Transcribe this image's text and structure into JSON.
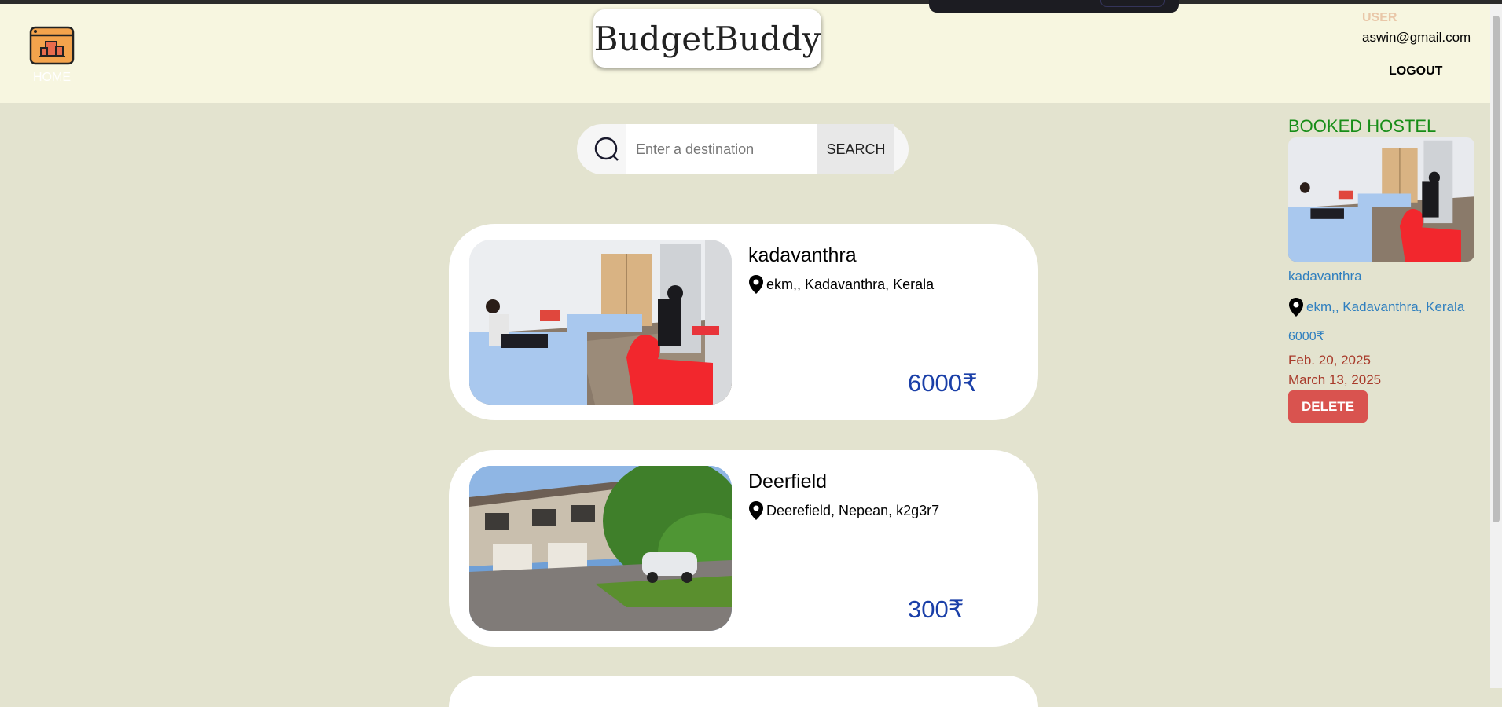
{
  "header": {
    "home_label": "HOME",
    "brand": "BudgetBuddy",
    "user_label": "USER",
    "user_email": "aswin@gmail.com",
    "logout_label": "LOGOUT"
  },
  "search": {
    "placeholder": "Enter a destination",
    "button_label": "SEARCH"
  },
  "listings": [
    {
      "name": "kadavanthra",
      "location": "ekm,, Kadavanthra, Kerala",
      "price": "6000₹",
      "image": "hostel-room"
    },
    {
      "name": "Deerfield",
      "location": "Deerefield, Nepean, k2g3r7",
      "price": "300₹",
      "image": "townhouse"
    }
  ],
  "booked": {
    "title": "BOOKED HOSTEL",
    "name": "kadavanthra",
    "location": "ekm,, Kadavanthra, Kerala",
    "price": "6000₹",
    "check_in": "Feb. 20, 2025",
    "check_out": "March 13, 2025",
    "delete_label": "DELETE"
  },
  "colors": {
    "page_bg": "#e3e3cf",
    "header_bg": "#f7f6e0",
    "price": "#1a3fa8",
    "booked_title": "#178d17",
    "booked_link": "#2f7fbf",
    "date": "#a83a2a",
    "delete": "#d9534f"
  },
  "icons": [
    "home-building-icon",
    "search-icon",
    "location-pin-icon"
  ]
}
